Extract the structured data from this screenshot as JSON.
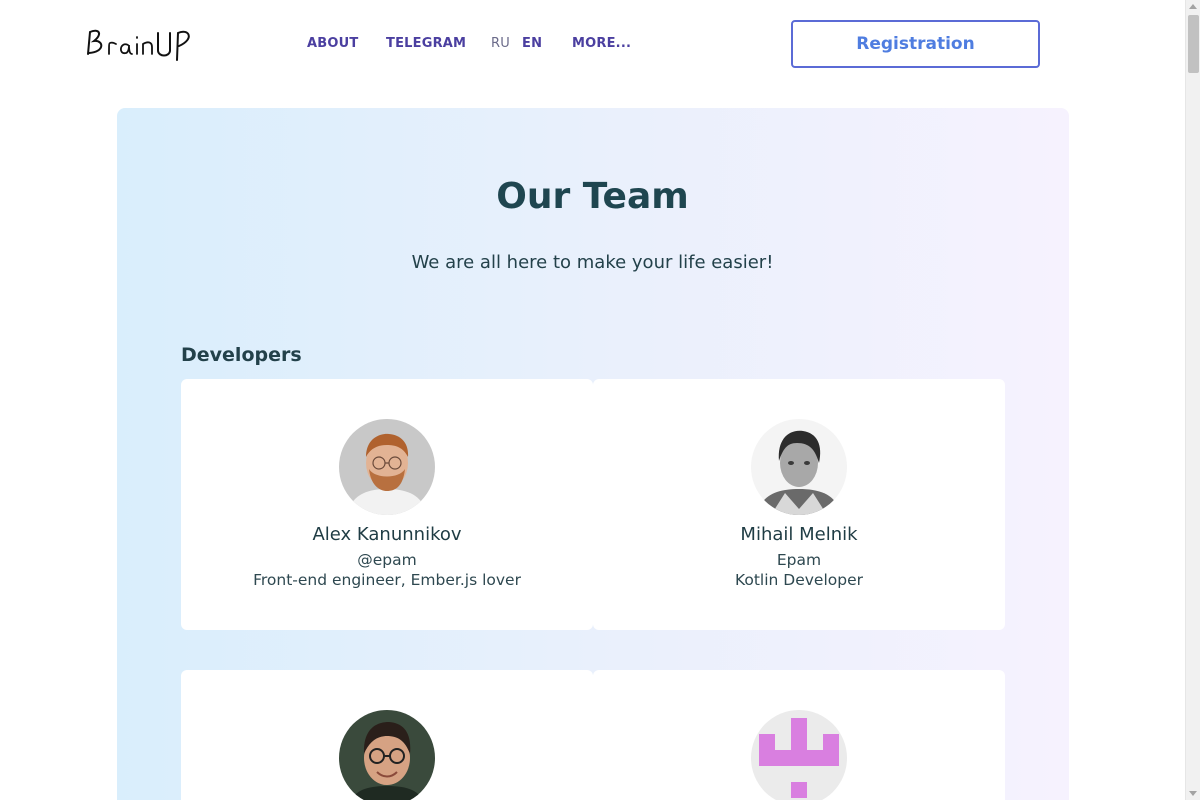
{
  "header": {
    "logo_text": "BrainUP",
    "nav": {
      "about": "ABOUT",
      "telegram": "TELEGRAM",
      "ru": "RU",
      "en": "EN",
      "more": "MORE..."
    },
    "registration": "Registration"
  },
  "main": {
    "title": "Our Team",
    "subtitle": "We are all here to make your life easier!",
    "section": "Developers",
    "members": [
      {
        "name": "Alex Kanunnikov",
        "org": "@epam",
        "role": "Front-end engineer, Ember.js lover"
      },
      {
        "name": "Mihail Melnik",
        "org": "Epam",
        "role": "Kotlin Developer"
      },
      {
        "name": "",
        "org": "",
        "role": ""
      },
      {
        "name": "",
        "org": "",
        "role": ""
      }
    ]
  },
  "colors": {
    "nav": "#4b3fa0",
    "title": "#1f4650",
    "button_border": "#5b6bd6",
    "button_text": "#4f7de0",
    "identicon": "#d97fe0"
  }
}
